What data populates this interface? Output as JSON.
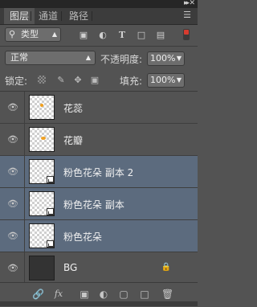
{
  "window": {
    "collapse_icon": "double-chevron-right-icon",
    "close_icon": "close-icon"
  },
  "tabs": [
    {
      "label": "图层",
      "active": true
    },
    {
      "label": "通道",
      "active": false
    },
    {
      "label": "路径",
      "active": false
    }
  ],
  "filter": {
    "kind_label": "类型",
    "icons": [
      "image-filter-icon",
      "adjustment-filter-icon",
      "type-filter-icon",
      "shape-filter-icon",
      "smart-object-filter-icon"
    ]
  },
  "blend": {
    "mode": "正常",
    "opacity_label": "不透明度:",
    "opacity_value": "100%"
  },
  "lock": {
    "label": "锁定:",
    "fill_label": "填充:",
    "fill_value": "100%"
  },
  "layers": [
    {
      "name": "花蕊",
      "selected": false,
      "smart": false,
      "locked": false,
      "thumb": "transparent"
    },
    {
      "name": "花瓣",
      "selected": false,
      "smart": false,
      "locked": false,
      "thumb": "transparent"
    },
    {
      "name": "粉色花朵 副本 2",
      "selected": true,
      "smart": true,
      "locked": false,
      "thumb": "transparent"
    },
    {
      "name": "粉色花朵 副本",
      "selected": true,
      "smart": true,
      "locked": false,
      "thumb": "transparent"
    },
    {
      "name": "粉色花朵",
      "selected": true,
      "smart": true,
      "locked": false,
      "thumb": "transparent"
    },
    {
      "name": "BG",
      "selected": false,
      "smart": false,
      "locked": true,
      "thumb": "dark"
    }
  ],
  "bottom_icons": [
    "link-icon",
    "fx-icon",
    "mask-icon",
    "adjustment-icon",
    "folder-icon",
    "new-layer-icon",
    "trash-icon"
  ],
  "colors": {
    "panel_bg": "#535353",
    "selected_bg": "#5c6b7e",
    "dot": "#f0a020"
  }
}
